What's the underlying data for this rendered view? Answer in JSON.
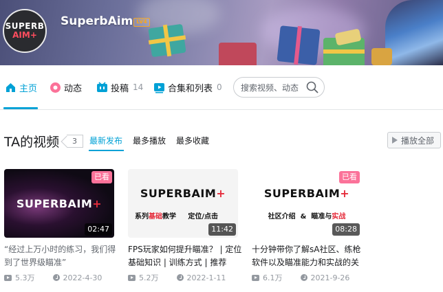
{
  "profile": {
    "name": "SuperbAim",
    "level": "LV4",
    "avatar_line1": "SUPERB",
    "avatar_line2": "AIM+"
  },
  "nav": {
    "items": [
      {
        "label": "主页",
        "count": "",
        "icon": "home-icon",
        "active": true
      },
      {
        "label": "动态",
        "count": "",
        "icon": "dynamic-icon"
      },
      {
        "label": "投稿",
        "count": "14",
        "icon": "upload-icon"
      },
      {
        "label": "合集和列表",
        "count": "0",
        "icon": "collection-icon"
      }
    ],
    "search": {
      "placeholder": "搜索视频、动态"
    }
  },
  "videos_section": {
    "title": "TA的视频",
    "count": "3",
    "tabs": [
      "最新发布",
      "最多播放",
      "最多收藏"
    ],
    "play_all": "播放全部"
  },
  "videos": [
    {
      "thumb_brand": "SUPERBAIM",
      "thumb_plus": "+",
      "thumb_sub": "",
      "seen": "已看",
      "duration": "02:47",
      "title": "“经过上万小时的练习，我们得到了世界级瞄准”",
      "plays": "5.3万",
      "date": "2022-4-30"
    },
    {
      "thumb_brand": "SUPERBAIM",
      "thumb_plus": "+",
      "thumb_sub_a": "系列",
      "thumb_sub_b": "基础",
      "thumb_sub_c": "教学     定位/点击",
      "seen": "",
      "duration": "11:42",
      "title": "FPS玩家如何提升瞄准？ | 定位基础知识 | 训练方式 | 推荐",
      "plays": "5.2万",
      "date": "2022-1-11"
    },
    {
      "thumb_brand": "SUPERBAIM",
      "thumb_plus": "+",
      "thumb_sub_a": "社区介绍  &  瞄准与",
      "thumb_sub_b": "实战",
      "seen": "已看",
      "duration": "08:28",
      "title": "十分钟带你了解sA社区、练枪软件以及瞄准能力和实战的关",
      "plays": "6.1万",
      "date": "2021-9-26"
    }
  ],
  "colors": {
    "accent": "#00a1d6",
    "pink": "#fb7299",
    "brand_red": "#e52c3b"
  }
}
